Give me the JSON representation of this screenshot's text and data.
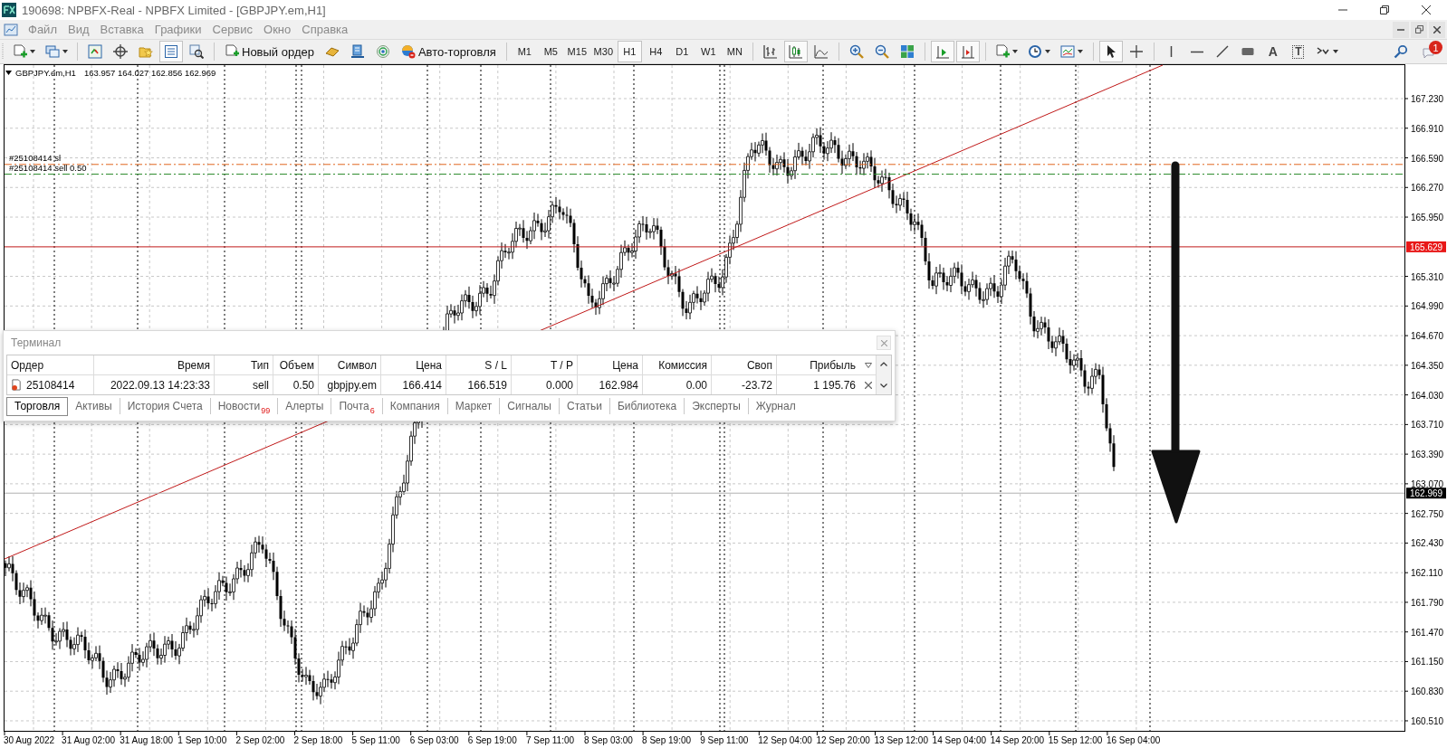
{
  "window": {
    "title": "190698: NPBFX-Real - NPBFX Limited - [GBPJPY.em,H1]"
  },
  "menu": [
    "Файл",
    "Вид",
    "Вставка",
    "Графики",
    "Сервис",
    "Окно",
    "Справка"
  ],
  "toolbar": {
    "new_order": "Новый ордер",
    "auto_trading": "Авто-торговля",
    "timeframes": [
      {
        "label": "M1",
        "selected": false
      },
      {
        "label": "M5",
        "selected": false
      },
      {
        "label": "M15",
        "selected": false
      },
      {
        "label": "M30",
        "selected": false
      },
      {
        "label": "H1",
        "selected": true
      },
      {
        "label": "H4",
        "selected": false
      },
      {
        "label": "D1",
        "selected": false
      },
      {
        "label": "W1",
        "selected": false
      },
      {
        "label": "MN",
        "selected": false
      }
    ],
    "toggles": [
      {
        "pressed": true
      },
      {
        "pressed": false
      },
      {
        "pressed": true
      },
      {
        "pressed": false
      },
      {
        "pressed": true
      },
      {
        "pressed": true
      },
      {
        "pressed": true
      },
      {
        "pressed": false
      }
    ],
    "text_tool": "A",
    "label_tool": "T",
    "notification_badge": "1"
  },
  "chart": {
    "symbol": "GBPJPY.em,H1",
    "ohlc": "163.957 164.027 162.856 162.969",
    "order_lines": [
      {
        "label": "#25108414 sl",
        "kind": "stop_loss"
      },
      {
        "label": "#25108414 sell 0.50",
        "kind": "entry"
      }
    ],
    "price_labels": [
      "167.230",
      "166.910",
      "166.590",
      "166.270",
      "165.950",
      "165.310",
      "164.990",
      "164.670",
      "164.350",
      "164.030",
      "163.710",
      "163.390",
      "163.070",
      "162.750",
      "162.430",
      "162.110",
      "161.790",
      "161.470",
      "161.150",
      "160.830",
      "160.510"
    ],
    "level_line": {
      "price": "165.629"
    },
    "bid_line": {
      "price": "162.969"
    },
    "time_labels": [
      "30 Aug 2022",
      "31 Aug 02:00",
      "31 Aug 18:00",
      "1 Sep 10:00",
      "2 Sep 02:00",
      "2 Sep 18:00",
      "5 Sep 11:00",
      "6 Sep 03:00",
      "6 Sep 19:00",
      "7 Sep 11:00",
      "8 Sep 03:00",
      "8 Sep 19:00",
      "9 Sep 11:00",
      "12 Sep 04:00",
      "12 Sep 20:00",
      "13 Sep 12:00",
      "14 Sep 04:00",
      "14 Sep 20:00",
      "15 Sep 12:00",
      "16 Sep 04:00"
    ]
  },
  "terminal": {
    "title": "Терминал",
    "columns": [
      "Ордер",
      "Время",
      "Тип",
      "Объем",
      "Символ",
      "Цена",
      "S / L",
      "T / P",
      "Цена",
      "Комиссия",
      "Своп",
      "Прибыль"
    ],
    "rows": [
      {
        "cells": [
          "25108414",
          "2022.09.13 14:23:33",
          "sell",
          "0.50",
          "gbpjpy.em",
          "166.414",
          "166.519",
          "0.000",
          "162.984",
          "0.00",
          "-23.72",
          "1 195.76"
        ]
      }
    ],
    "tabs": [
      {
        "label": "Торговля",
        "selected": true
      },
      {
        "label": "Активы",
        "selected": false
      },
      {
        "label": "История Счета",
        "selected": false
      },
      {
        "label": "Новости",
        "badge": "99",
        "selected": false
      },
      {
        "label": "Алерты",
        "selected": false
      },
      {
        "label": "Почта",
        "badge": "6",
        "selected": false
      },
      {
        "label": "Компания",
        "selected": false
      },
      {
        "label": "Маркет",
        "selected": false
      },
      {
        "label": "Сигналы",
        "selected": false
      },
      {
        "label": "Статьи",
        "selected": false
      },
      {
        "label": "Библиотека",
        "selected": false
      },
      {
        "label": "Эксперты",
        "selected": false
      },
      {
        "label": "Журнал",
        "selected": false
      }
    ]
  }
}
